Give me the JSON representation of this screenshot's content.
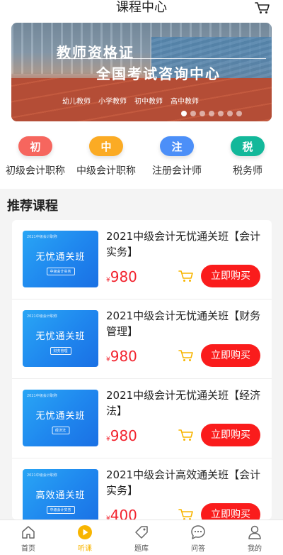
{
  "header": {
    "title": "课程中心",
    "cart_icon": "cart-icon"
  },
  "banner": {
    "line1": "教师资格证",
    "line2": "全国考试咨询中心",
    "tags": [
      "幼儿教师",
      "小学教师",
      "初中教师",
      "高中教师"
    ],
    "slide_count": 7,
    "active_slide": 1
  },
  "categories": [
    {
      "badge": "初",
      "label": "初级会计职称",
      "color": "#f6665e"
    },
    {
      "badge": "中",
      "label": "中级会计职称",
      "color": "#fbab24"
    },
    {
      "badge": "注",
      "label": "注册会计师",
      "color": "#4c8ff8"
    },
    {
      "badge": "税",
      "label": "税务师",
      "color": "#13b89a"
    }
  ],
  "section": {
    "title": "推荐课程"
  },
  "courses": [
    {
      "thumb_top": "2021中级会计职称",
      "thumb_main": "无忧通关班",
      "thumb_sub": "中级会计实务",
      "title": "2021中级会计无忧通关班【会计实务】",
      "currency": "¥",
      "price": "980",
      "buy_label": "立即购买"
    },
    {
      "thumb_top": "2021中级会计职称",
      "thumb_main": "无忧通关班",
      "thumb_sub": "财务管理",
      "title": "2021中级会计无忧通关班【财务管理】",
      "currency": "¥",
      "price": "980",
      "buy_label": "立即购买"
    },
    {
      "thumb_top": "2021中级会计职称",
      "thumb_main": "无忧通关班",
      "thumb_sub": "经济法",
      "title": "2021中级会计无忧通关班【经济法】",
      "currency": "¥",
      "price": "980",
      "buy_label": "立即购买"
    },
    {
      "thumb_top": "2021中级会计职称",
      "thumb_main": "高效通关班",
      "thumb_sub": "中级会计实务",
      "title": "2021中级会计高效通关班【会计实务】",
      "currency": "¥",
      "price": "400",
      "buy_label": "立即购买"
    }
  ],
  "colors": {
    "accent": "#f8b500",
    "price": "#f2232e",
    "buy_button": "#fa1c1c"
  },
  "tabbar": [
    {
      "label": "首页",
      "icon": "home-icon",
      "active": false
    },
    {
      "label": "听课",
      "icon": "play-icon",
      "active": true
    },
    {
      "label": "题库",
      "icon": "tag-icon",
      "active": false
    },
    {
      "label": "问答",
      "icon": "chat-icon",
      "active": false
    },
    {
      "label": "我的",
      "icon": "user-icon",
      "active": false
    }
  ]
}
